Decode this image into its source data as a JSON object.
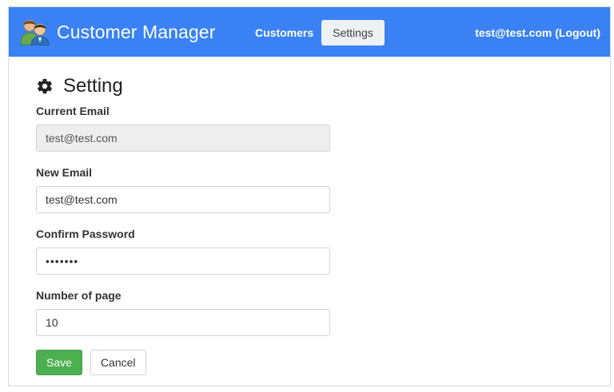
{
  "header": {
    "brand_title": "Customer Manager",
    "nav": [
      {
        "label": "Customers",
        "active": false
      },
      {
        "label": "Settings",
        "active": true
      }
    ],
    "user": "test@test.com (Logout)",
    "bg_color": "#3a82f4"
  },
  "page": {
    "title": "Setting",
    "icon": "gear-icon"
  },
  "form": {
    "current_email": {
      "label": "Current Email",
      "value": "test@test.com",
      "disabled": true
    },
    "new_email": {
      "label": "New Email",
      "value": "test@test.com"
    },
    "confirm_password": {
      "label": "Confirm Password",
      "value": "•••••••"
    },
    "page_count": {
      "label": "Number of page",
      "value": "10"
    },
    "save_label": "Save",
    "cancel_label": "Cancel",
    "save_color": "#4caf50"
  }
}
